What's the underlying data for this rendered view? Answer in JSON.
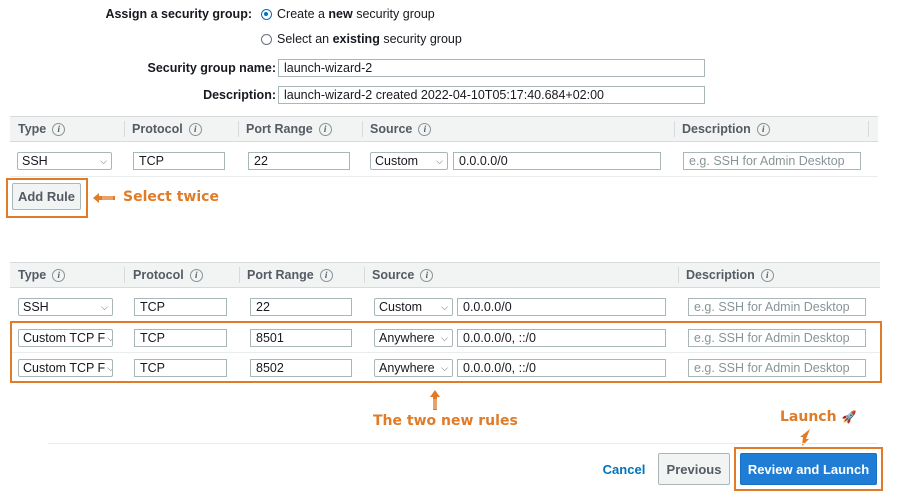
{
  "form": {
    "assign_label": "Assign a security group:",
    "options": [
      {
        "pre": "Create a ",
        "bold": "new",
        "post": " security group",
        "selected": true
      },
      {
        "pre": "Select an ",
        "bold": "existing",
        "post": " security group",
        "selected": false
      }
    ],
    "name_label": "Security group name:",
    "name_value": "launch-wizard-2",
    "desc_label": "Description:",
    "desc_value": "launch-wizard-2 created 2022-04-10T05:17:40.684+02:00"
  },
  "table_headers": {
    "type": "Type",
    "protocol": "Protocol",
    "port_range": "Port Range",
    "source": "Source",
    "description": "Description",
    "info_glyph": "i"
  },
  "table1": {
    "rows": [
      {
        "type": "SSH",
        "protocol": "TCP",
        "port": "22",
        "source_type": "Custom",
        "source": "0.0.0.0/0",
        "desc_placeholder": "e.g. SSH for Admin Desktop"
      }
    ]
  },
  "add_rule_label": "Add Rule",
  "annotations": {
    "select_twice": "Select twice",
    "new_rules": "The two new rules",
    "launch": "Launch"
  },
  "table2": {
    "rows": [
      {
        "type": "SSH",
        "protocol": "TCP",
        "port": "22",
        "source_type": "Custom",
        "source": "0.0.0.0/0",
        "desc_placeholder": "e.g. SSH for Admin Desktop"
      },
      {
        "type": "Custom TCP F",
        "protocol": "TCP",
        "port": "8501",
        "source_type": "Anywhere",
        "source": "0.0.0.0/0, ::/0",
        "desc_placeholder": "e.g. SSH for Admin Desktop"
      },
      {
        "type": "Custom TCP F",
        "protocol": "TCP",
        "port": "8502",
        "source_type": "Anywhere",
        "source": "0.0.0.0/0, ::/0",
        "desc_placeholder": "e.g. SSH for Admin Desktop"
      }
    ]
  },
  "footer": {
    "cancel": "Cancel",
    "previous": "Previous",
    "review_launch": "Review and Launch"
  },
  "colors": {
    "annotation": "#e07b28",
    "primary": "#1f7dd6",
    "link": "#0073bb"
  },
  "icons": [
    "info-icon",
    "radio-icon",
    "caret-down-icon",
    "arrow-left-icon",
    "arrow-up-icon",
    "arrow-down-icon",
    "rocket-icon"
  ]
}
